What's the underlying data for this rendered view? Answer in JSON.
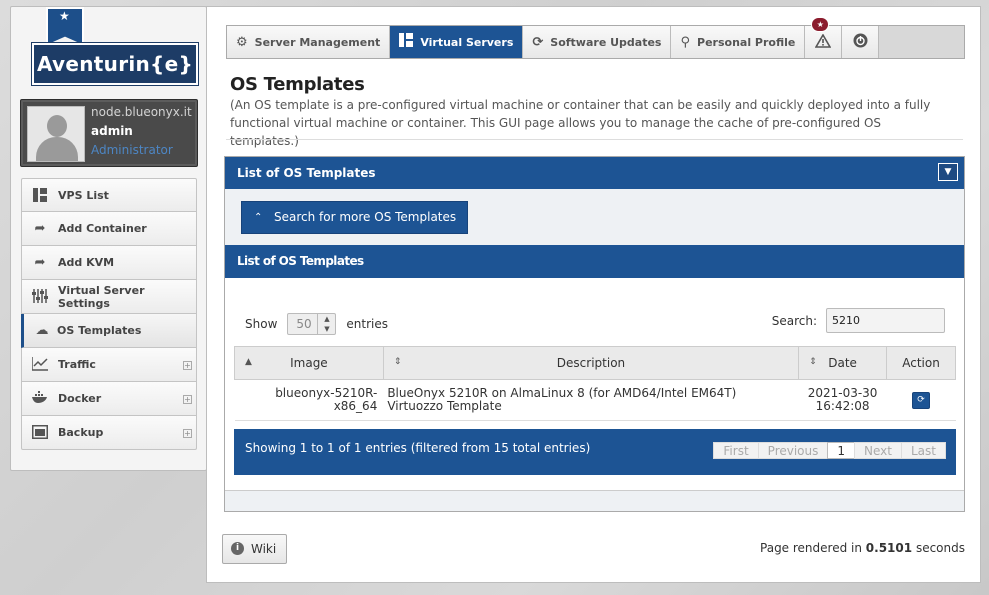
{
  "logo": {
    "text": "Aventurin{e}",
    "ribbon_icon": "star-icon"
  },
  "user": {
    "node": "node.blueonyx.it",
    "name": "admin",
    "role": "Administrator"
  },
  "sidebar": {
    "items": [
      {
        "label": "VPS List",
        "icon": "grid-icon",
        "active": false,
        "expandable": false
      },
      {
        "label": "Add Container",
        "icon": "share-arrow-icon",
        "active": false,
        "expandable": false
      },
      {
        "label": "Add KVM",
        "icon": "share-arrow-icon",
        "active": false,
        "expandable": false
      },
      {
        "label": "Virtual Server Settings",
        "icon": "sliders-icon",
        "active": false,
        "expandable": false
      },
      {
        "label": "OS Templates",
        "icon": "cloud-icon",
        "active": true,
        "expandable": false
      },
      {
        "label": "Traffic",
        "icon": "line-chart-icon",
        "active": false,
        "expandable": true
      },
      {
        "label": "Docker",
        "icon": "docker-icon",
        "active": false,
        "expandable": true
      },
      {
        "label": "Backup",
        "icon": "backup-icon",
        "active": false,
        "expandable": true
      }
    ]
  },
  "tabs": {
    "server_management": "Server Management",
    "virtual_servers": "Virtual Servers",
    "software_updates": "Software Updates",
    "personal_profile": "Personal Profile",
    "alert_badge": "★"
  },
  "page": {
    "title": "OS Templates",
    "description": "(An OS template is a pre-configured virtual machine or container that can be easily and quickly deployed into a fully functional virtual machine or container. This GUI page allows you to manage the cache of pre-configured OS templates.)"
  },
  "panel": {
    "title": "List of OS Templates",
    "search_more_label": "Search for more OS Templates",
    "sub_title": "List of OS Templates",
    "show_label": "Show",
    "entries_label": "entries",
    "page_length": "50",
    "search_label": "Search:",
    "search_value": "5210",
    "columns": [
      "Image",
      "Description",
      "Date",
      "Action"
    ],
    "rows": [
      {
        "image_line1": "blueonyx-5210R-",
        "image_line2": "x86_64",
        "desc_line1": "BlueOnyx 5210R on AlmaLinux 8 (for AMD64/Intel EM64T)",
        "desc_line2": "Virtuozzo Template",
        "date_line1": "2021-03-30",
        "date_line2": "16:42:08",
        "action_icon": "refresh-icon"
      }
    ],
    "info": "Showing 1 to 1 of 1 entries (filtered from 15 total entries)",
    "pager": {
      "first": "First",
      "previous": "Previous",
      "current": "1",
      "next": "Next",
      "last": "Last"
    }
  },
  "footer": {
    "wiki_label": "Wiki",
    "rendered_prefix": "Page rendered in",
    "rendered_value": "0.5101",
    "rendered_suffix": "seconds"
  },
  "colors": {
    "accent": "#1d5494",
    "logo_bg": "#1d3c66",
    "badge": "#8b1c2d"
  }
}
